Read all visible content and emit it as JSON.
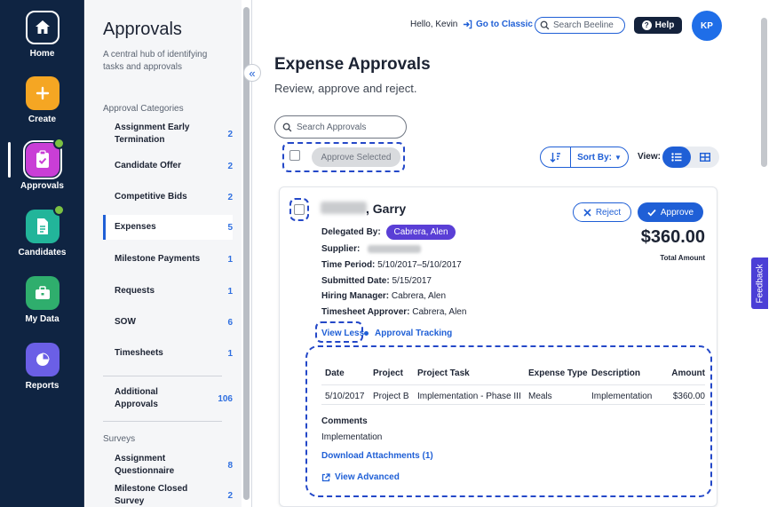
{
  "rail": {
    "items": [
      {
        "label": "Home",
        "icon": "home-icon"
      },
      {
        "label": "Create",
        "icon": "plus-icon"
      },
      {
        "label": "Approvals",
        "icon": "clipboard-check-icon"
      },
      {
        "label": "Candidates",
        "icon": "document-icon"
      },
      {
        "label": "My Data",
        "icon": "briefcase-icon"
      },
      {
        "label": "Reports",
        "icon": "pie-chart-icon"
      }
    ]
  },
  "panel": {
    "title": "Approvals",
    "subtitle": "A central hub of identifying tasks and approvals",
    "categories_label": "Approval Categories",
    "categories": [
      {
        "name": "Assignment Early Termination",
        "count": "2"
      },
      {
        "name": "Candidate Offer",
        "count": "2"
      },
      {
        "name": "Competitive Bids",
        "count": "2"
      },
      {
        "name": "Expenses",
        "count": "5"
      },
      {
        "name": "Milestone Payments",
        "count": "1"
      },
      {
        "name": "Requests",
        "count": "1"
      },
      {
        "name": "SOW",
        "count": "6"
      },
      {
        "name": "Timesheets",
        "count": "1"
      }
    ],
    "additional": {
      "name": "Additional Approvals",
      "count": "106"
    },
    "surveys_label": "Surveys",
    "surveys": [
      {
        "name": "Assignment Questionnaire",
        "count": "8"
      },
      {
        "name": "Milestone Closed Survey",
        "count": "2"
      }
    ]
  },
  "header": {
    "greeting": "Hello, Kevin",
    "classic_link": "Go to Classic",
    "search_placeholder": "Search Beeline",
    "help_label": "Help",
    "avatar_initials": "KP"
  },
  "main": {
    "title": "Expense Approvals",
    "subtitle": "Review, approve and reject.",
    "search_placeholder": "Search Approvals",
    "approve_selected": "Approve Selected",
    "sort_by": "Sort By:",
    "view_label": "View:"
  },
  "card": {
    "name_suffix": ", Garry",
    "delegated_label": "Delegated By:",
    "delegated_value": "Cabrera, Alen",
    "supplier_label": "Supplier:",
    "time_period_label": "Time Period:",
    "time_period_value": "5/10/2017–5/10/2017",
    "submitted_label": "Submitted Date:",
    "submitted_value": "5/15/2017",
    "hiring_manager_label": "Hiring Manager:",
    "hiring_manager_value": "Cabrera, Alen",
    "timesheet_approver_label": "Timesheet Approver:",
    "timesheet_approver_value": "Cabrera, Alen",
    "reject_label": "Reject",
    "approve_label": "Approve",
    "amount": "$360.00",
    "amount_label": "Total Amount",
    "view_less": "View Less",
    "approval_tracking": "Approval Tracking",
    "table": {
      "headers": [
        "Date",
        "Project",
        "Project Task",
        "Expense Type",
        "Description",
        "Amount"
      ],
      "rows": [
        [
          "5/10/2017",
          "Project B",
          "Implementation - Phase III",
          "Meals",
          "Implementation",
          "$360.00"
        ]
      ]
    },
    "comments_label": "Comments",
    "comments_value": "Implementation",
    "download_attachments": "Download Attachments (1)",
    "view_advanced": "View Advanced"
  },
  "feedback_label": "Feedback"
}
